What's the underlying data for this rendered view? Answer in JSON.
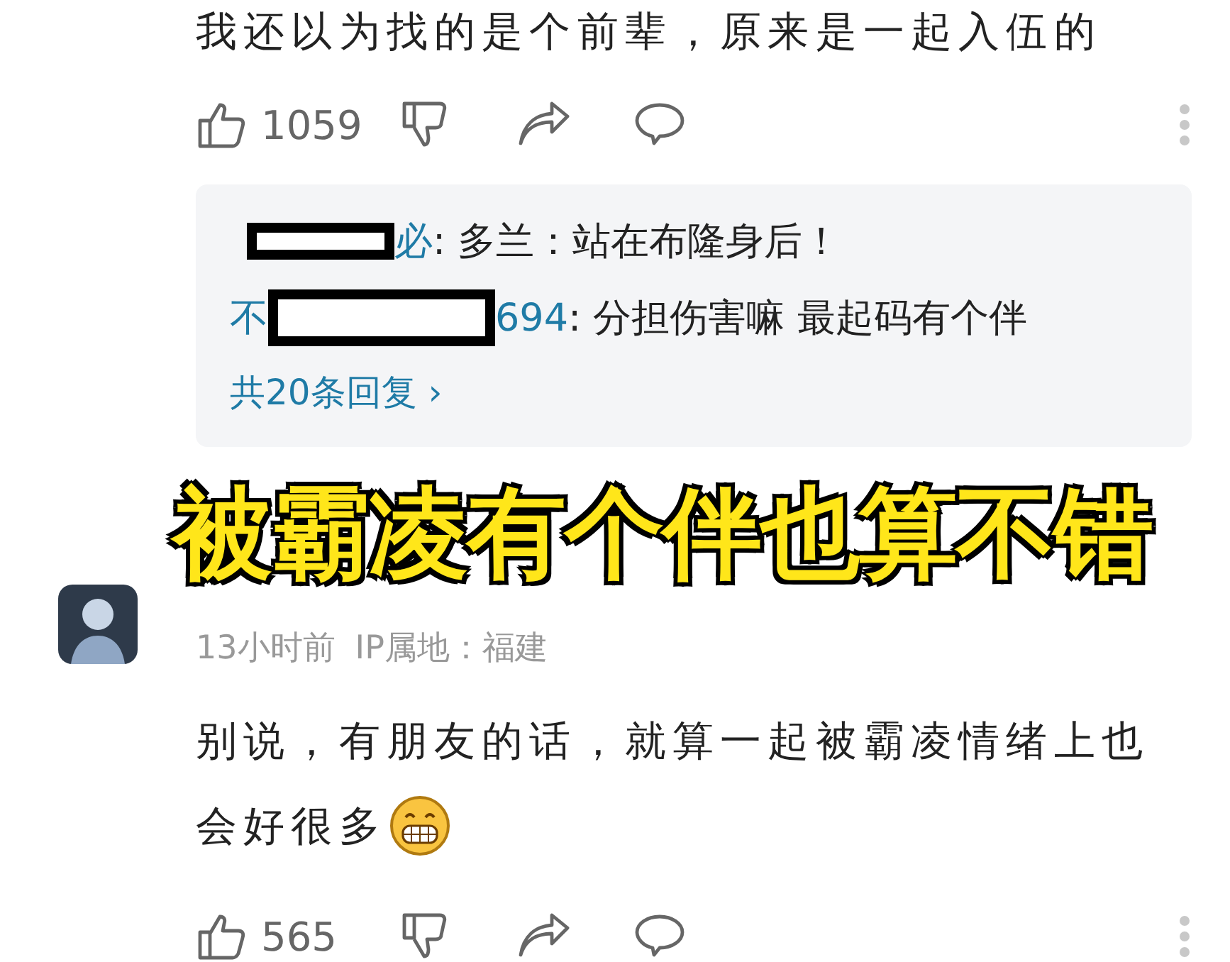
{
  "comment_top": {
    "text": "我还以为找的是个前辈，原来是一起入伍的",
    "like_count": "1059"
  },
  "replies": [
    {
      "author_tail": "必",
      "text": ": 多兰：站在布隆身后！"
    },
    {
      "author_head": "不",
      "author_tail": "694",
      "text": ": 分担伤害嘛 最起码有个伴"
    }
  ],
  "reply_more": "共20条回复 ›",
  "caption": "被霸凌有个伴也算不错",
  "comment": {
    "time": "13小时前",
    "ip": "IP属地：福建",
    "lines": [
      "别说，有朋友的话，就算一起被霸凌情绪上也",
      "会好很多"
    ],
    "emoji": true,
    "like_count": "565"
  }
}
